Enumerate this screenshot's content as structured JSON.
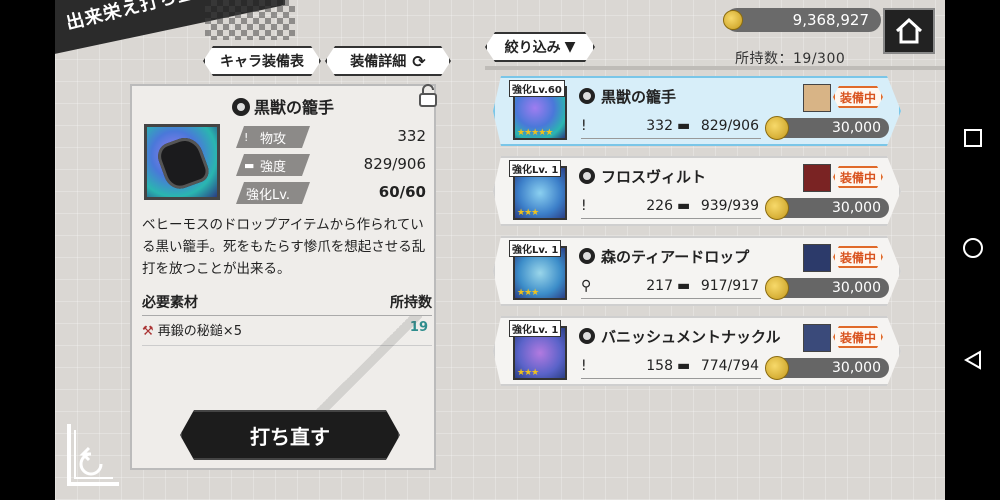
{
  "screen_title": "出来栄え打ち直し",
  "buttons": {
    "chara_equip": "キャラ装備表",
    "equip_detail": "装備詳細",
    "filter": "絞り込み",
    "reforge": "打ち直す"
  },
  "header": {
    "gold": "9,368,927",
    "possession": "所持数：19/300"
  },
  "selected_item": {
    "name": "黒獣の籠手",
    "stats": [
      {
        "label": "物攻",
        "value": "332"
      },
      {
        "label": "強度",
        "value": "829/906"
      },
      {
        "label": "強化Lv.",
        "value": "60/60"
      }
    ],
    "description": "ベヒーモスのドロップアイテムから作られている黒い籠手。死をもたらす惨爪を想起させる乱打を放つことが出来る。",
    "required_materials_label": "必要素材",
    "owned_label": "所持数",
    "material": {
      "name": "再鍛の秘鎚×5",
      "owned": "19"
    }
  },
  "items": [
    {
      "level": "強化Lv.60",
      "name": "黒獣の籠手",
      "stat1": "332",
      "durability": "829/906",
      "status": "装備中",
      "cost": "30,000",
      "stars": "★★★★★"
    },
    {
      "level": "強化Lv. 1",
      "name": "フロスヴィルト",
      "stat1": "226",
      "durability": "939/939",
      "status": "装備中",
      "cost": "30,000",
      "stars": "★★★"
    },
    {
      "level": "強化Lv. 1",
      "name": "森のティアードロップ",
      "stat1": "217",
      "durability": "917/917",
      "status": "装備中",
      "cost": "30,000",
      "stars": "★★★"
    },
    {
      "level": "強化Lv. 1",
      "name": "バニッシュメントナックル",
      "stat1": "158",
      "durability": "774/794",
      "status": "装備中",
      "cost": "30,000",
      "stars": "★★★"
    }
  ],
  "colors": {
    "equipped": "#d9531e",
    "selected_card": "#d7eef9",
    "owned_count": "#2f8d8d"
  }
}
